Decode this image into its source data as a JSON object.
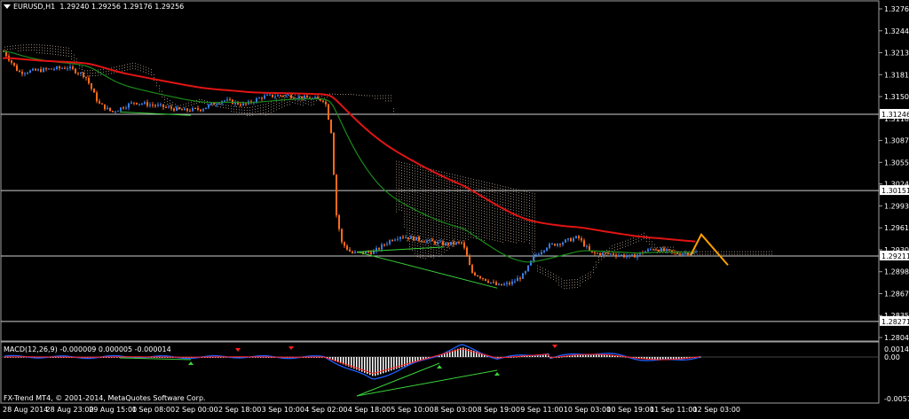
{
  "header": {
    "symbol_timeframe": "EURUSD,H1",
    "ohlc": "1.29240 1.29256 1.29176 1.29256"
  },
  "macd": {
    "label": "MACD(12,26,9)",
    "values": "-0.000009 0.000005 -0.000014"
  },
  "copyright": "FX-Trend MT4, © 2001-2014, MetaQuotes Software Corp.",
  "price_axis": [
    "1.32760",
    "1.32445",
    "1.32130",
    "1.31815",
    "1.31500",
    "1.31185",
    "1.30870",
    "1.30555",
    "1.30245",
    "1.29930",
    "1.29615",
    "1.29300",
    "1.28985",
    "1.28670",
    "1.28355",
    "1.28040"
  ],
  "price_boxes": [
    "1.31246",
    "1.30151",
    "1.29211",
    "1.28271"
  ],
  "macd_axis": [
    "0.00141",
    "0.00",
    "-0.00578"
  ],
  "time_axis": [
    "28 Aug 2014",
    "28 Aug 23:00",
    "29 Aug 15:00",
    "1 Sep 08:00",
    "2 Sep 00:00",
    "2 Sep 18:00",
    "3 Sep 10:00",
    "4 Sep 02:00",
    "4 Sep 18:00",
    "5 Sep 10:00",
    "8 Sep 03:00",
    "8 Sep 19:00",
    "9 Sep 11:00",
    "10 Sep 03:00",
    "10 Sep 19:00",
    "11 Sep 11:00",
    "12 Sep 03:00"
  ],
  "colors": {
    "background": "#000000",
    "grid": "#a0a0a0",
    "bull_candle": "#3a7be0",
    "bear_candle": "#ff6a1a",
    "ma_red": "#e11414",
    "ma_green": "#1b8a1b",
    "ichimoku_cloud": "#c8b4a0",
    "projection": "#ffa000",
    "macd_hist": "#ffffff",
    "macd_blue": "#2060ff",
    "macd_red": "#ff2020",
    "divergence": "#3ad23a"
  }
}
